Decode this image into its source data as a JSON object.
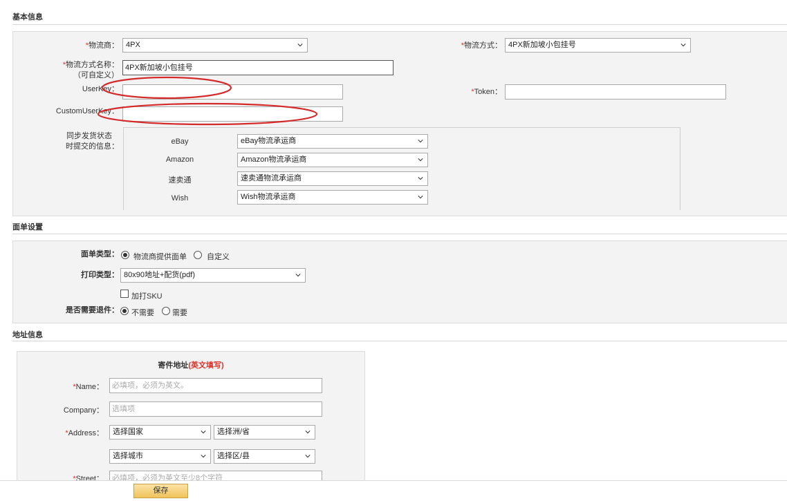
{
  "basic": {
    "title": "基本信息",
    "carrier_label": "物流商：",
    "carrier_value": "4PX",
    "method_label": "物流方式：",
    "method_value": "4PX新加坡小包挂号",
    "method_name_label": "物流方式名称：",
    "method_name_sub": "（可自定义）",
    "method_name_value": "4PX新加坡小包挂号",
    "userkey_label": "UserKey：",
    "userkey_value": "",
    "token_label": "Token：",
    "token_value": "",
    "customuserkey_label": "CustomUserKey：",
    "customuserkey_value": "",
    "sync_label_line1": "同步发货状态",
    "sync_label_line2": "时提交的信息：",
    "platforms": [
      {
        "name": "eBay",
        "value": "eBay物流承运商"
      },
      {
        "name": "Amazon",
        "value": "Amazon物流承运商"
      },
      {
        "name": "速卖通",
        "value": "速卖通物流承运商"
      },
      {
        "name": "Wish",
        "value": "Wish物流承运商"
      }
    ]
  },
  "label_settings": {
    "title": "面单设置",
    "type_label": "面单类型：",
    "type_options": [
      "物流商提供面单",
      "自定义"
    ],
    "type_selected": "物流商提供面单",
    "print_label": "打印类型：",
    "print_value": "80x90地址+配货(pdf)",
    "add_sku_label": "加打SKU",
    "add_sku_checked": false,
    "return_label": "是否需要退件：",
    "return_options": [
      "不需要",
      "需要"
    ],
    "return_selected": "不需要"
  },
  "address": {
    "title": "地址信息",
    "sender_title": "寄件地址",
    "sender_note": "(英文填写)",
    "name_label": "Name：",
    "name_placeholder": "必填项，必须为英文。",
    "company_label": "Company：",
    "company_placeholder": "选填项",
    "address_label": "Address：",
    "country_value": "选择国家",
    "state_value": "选择洲/省",
    "city_value": "选择城市",
    "district_value": "选择区/县",
    "street_label": "Street：",
    "street_placeholder": "必填项，必须为英文至少8个字符"
  },
  "footer": {
    "save_label": "保存"
  },
  "colors": {
    "required": "#d9332b",
    "annotation": "#d42a2a",
    "panel_bg": "#f3f3f3",
    "save_button": "#f0c35a"
  }
}
